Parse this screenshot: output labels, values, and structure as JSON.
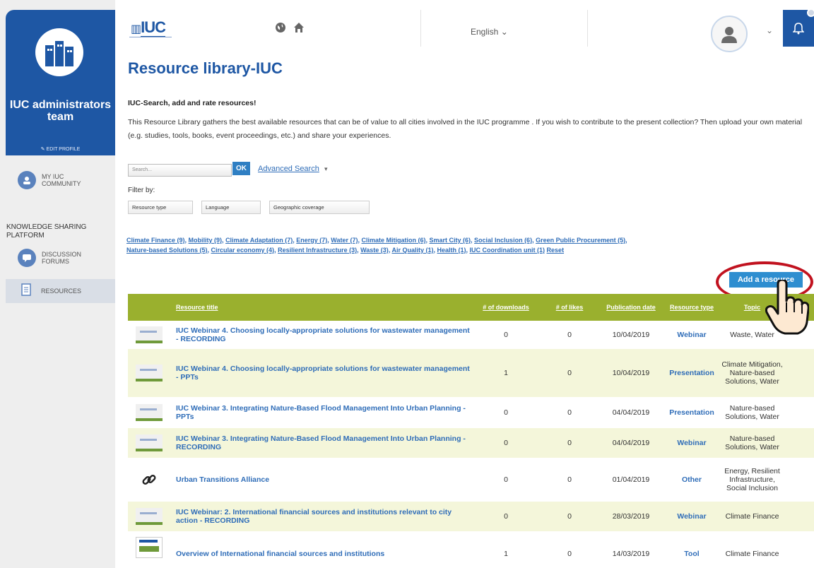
{
  "sidebar": {
    "team_name": "IUC administrators team",
    "edit_profile": "EDIT PROFILE",
    "community": "MY IUC COMMUNITY",
    "knowledge_title": "KNOWLEDGE SHARING PLATFORM",
    "forums": "DISCUSSION FORUMS",
    "resources": "RESOURCES"
  },
  "topbar": {
    "logo": "IUC",
    "language": "English"
  },
  "page": {
    "title": "Resource library-IUC",
    "subheading": "IUC-Search, add and rate resources!",
    "description": "This Resource Library gathers the best available resources that can be of value to all cities involved in the IUC programme . If you wish to contribute to the present collection? Then upload your own material (e.g. studies, tools, books, event proceedings, etc.) and share your experiences."
  },
  "search": {
    "placeholder": "Search...",
    "ok_label": "OK",
    "advanced_label": "Advanced Search"
  },
  "filters": {
    "label": "Filter by:",
    "options": [
      "Resource type",
      "Language",
      "Geographic coverage"
    ]
  },
  "tags": [
    "Climate Finance (9)",
    "Mobility (9)",
    "Climate Adaptation (7)",
    "Energy (7)",
    "Water (7)",
    "Climate Mitigation (6)",
    "Smart City (6)",
    "Social Inclusion (6)",
    "Green Public Procurement (5)",
    "Nature-based Solutions (5)",
    "Circular economy (4)",
    "Resilient Infrastructure (3)",
    "Waste (3)",
    "Air Quality (1)",
    "Health (1)",
    "IUC Coordination unit (1)",
    "Reset"
  ],
  "add_resource_label": "Add a resource",
  "table": {
    "headers": [
      "Resource title",
      "# of downloads",
      "# of likes",
      "Publication date",
      "Resource type",
      "Topic"
    ],
    "rows": [
      {
        "title": "IUC Webinar 4. Choosing locally-appropriate solutions for wastewater management - RECORDING",
        "downloads": "0",
        "likes": "0",
        "date": "10/04/2019",
        "type": "Webinar",
        "topic": "Waste, Water",
        "thumb": "slide"
      },
      {
        "title": "IUC Webinar 4. Choosing locally-appropriate solutions for wastewater management - PPTs",
        "downloads": "1",
        "likes": "0",
        "date": "10/04/2019",
        "type": "Presentation",
        "topic": "Climate Mitigation, Nature-based Solutions, Water",
        "thumb": "slide"
      },
      {
        "title": "IUC Webinar 3. Integrating Nature-Based Flood Management Into Urban Planning - PPTs",
        "downloads": "0",
        "likes": "0",
        "date": "04/04/2019",
        "type": "Presentation",
        "topic": "Nature-based Solutions, Water",
        "thumb": "slide"
      },
      {
        "title": "IUC Webinar 3. Integrating Nature-Based Flood Management Into Urban Planning - RECORDING",
        "downloads": "0",
        "likes": "0",
        "date": "04/04/2019",
        "type": "Webinar",
        "topic": "Nature-based Solutions, Water",
        "thumb": "slide"
      },
      {
        "title": "Urban Transitions Alliance",
        "downloads": "0",
        "likes": "0",
        "date": "01/04/2019",
        "type": "Other",
        "topic": "Energy, Resilient Infrastructure, Social Inclusion",
        "thumb": "link"
      },
      {
        "title": "IUC Webinar: 2. International financial sources and institutions relevant to city action - RECORDING",
        "downloads": "0",
        "likes": "0",
        "date": "28/03/2019",
        "type": "Webinar",
        "topic": "Climate Finance",
        "thumb": "slide"
      },
      {
        "title": "Overview of International financial sources and institutions",
        "downloads": "1",
        "likes": "0",
        "date": "14/03/2019",
        "type": "Tool",
        "topic": "Climate Finance",
        "thumb": "doc"
      }
    ]
  },
  "colors": {
    "brand_blue": "#1e57a4",
    "table_header": "#9ab02e",
    "row_alt": "#f4f6da",
    "highlight_red": "#c1121f"
  }
}
